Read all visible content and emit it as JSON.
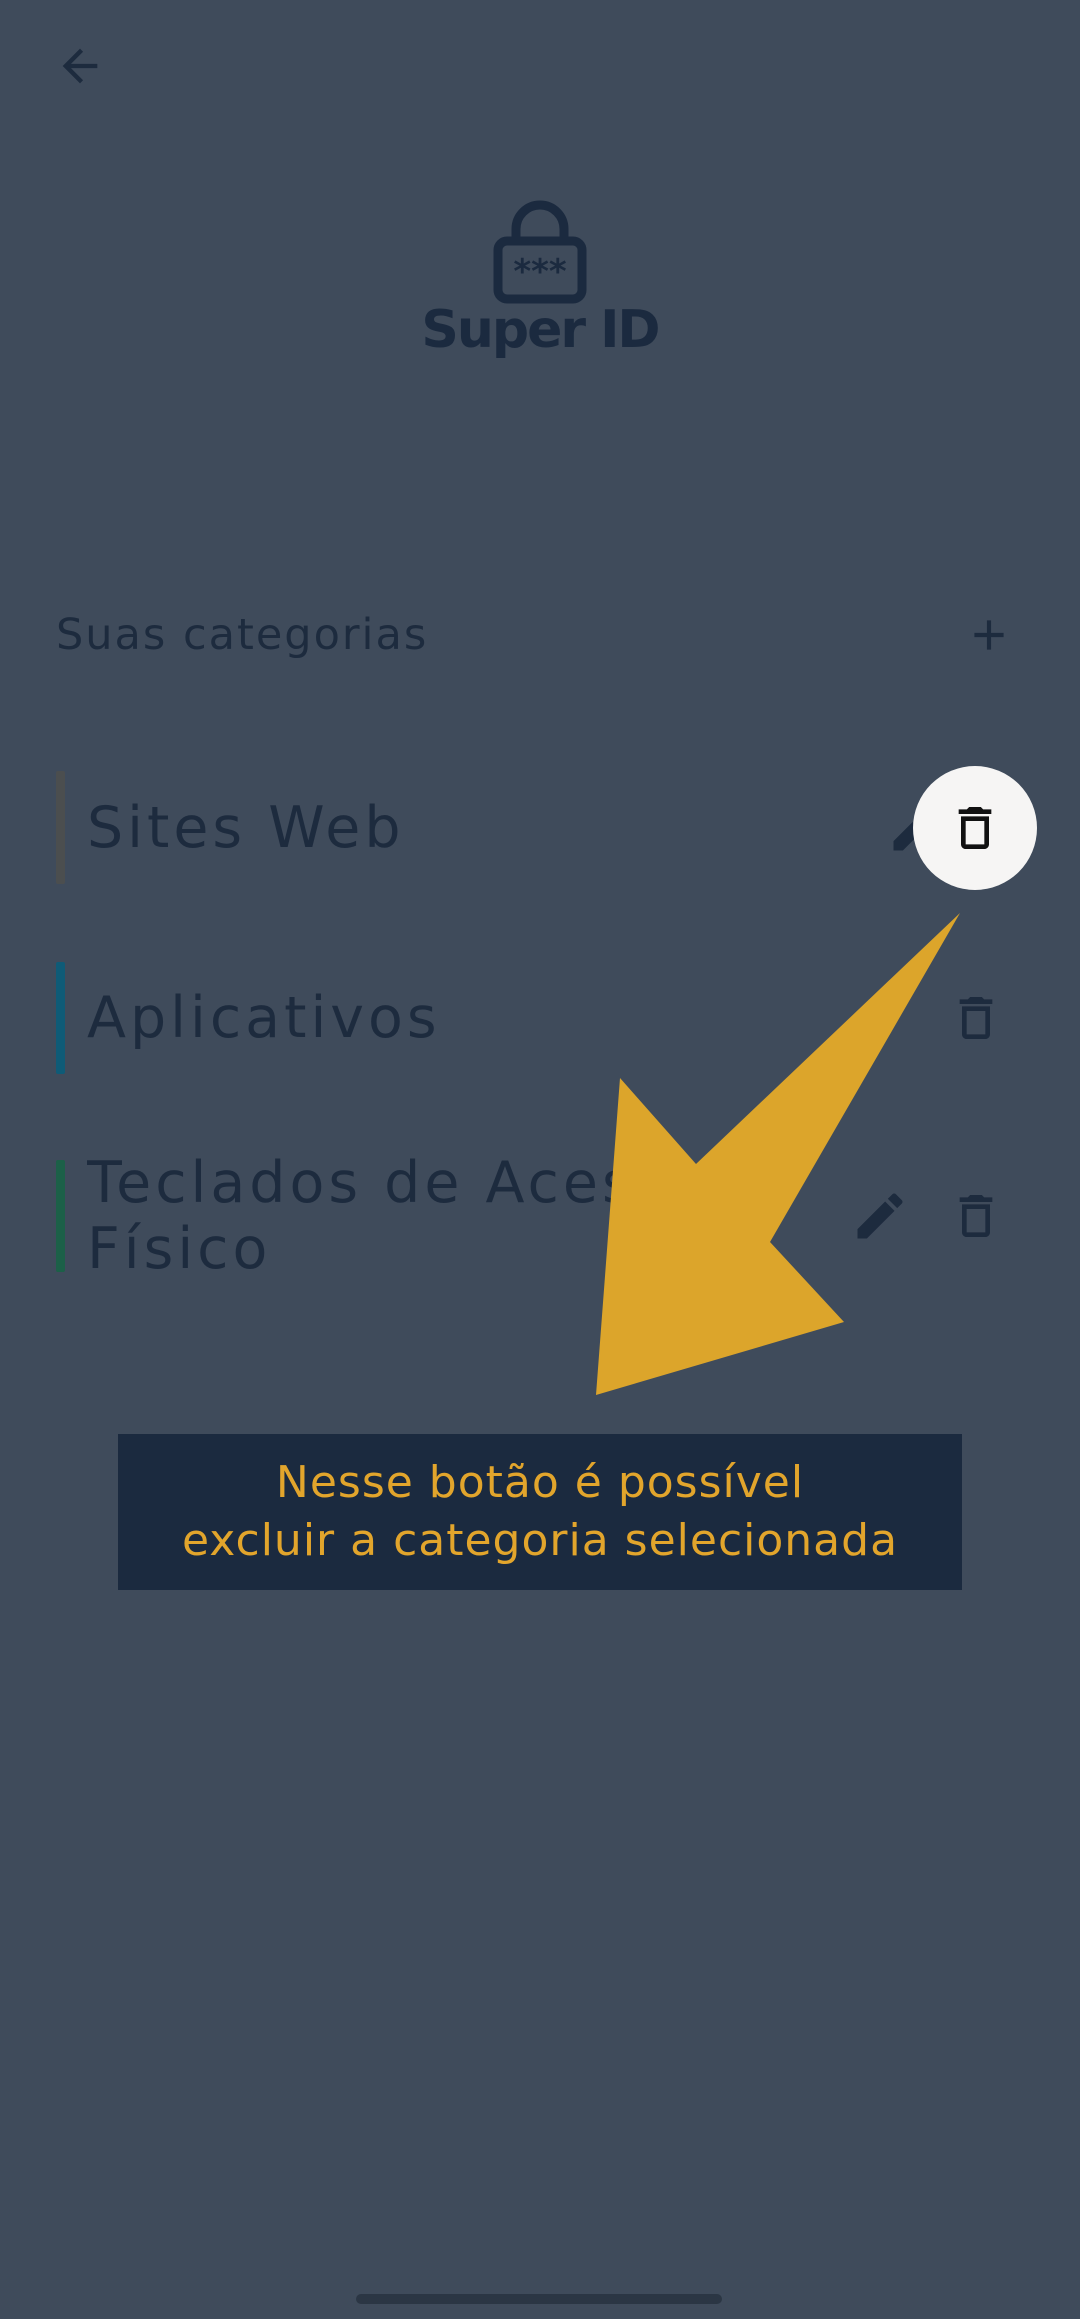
{
  "header": {
    "back_icon": "arrow-left-icon",
    "app_icon": "lock-icon",
    "app_name": "Super ID"
  },
  "categories_section": {
    "title": "Suas categorias",
    "add_icon": "plus-icon"
  },
  "categories": [
    {
      "label": "Sites Web",
      "color": "#4b4e4f",
      "editable": true
    },
    {
      "label": "Aplicativos",
      "color": "#0f5b77",
      "editable": false
    },
    {
      "label": "Teclados de Acess\nFísico",
      "color": "#1c6048",
      "editable": true
    }
  ],
  "tutorial": {
    "line1": "Nesse botão é possível",
    "line2": "excluir a categoria selecionada",
    "highlight_color": "#f6f5f4",
    "arrow_color": "#dca52b"
  },
  "colors": {
    "background": "#3f4b5b",
    "text_dark": "#1d2b3e",
    "tooltip_bg": "#1b2a3f",
    "tooltip_text": "#e2a52c"
  }
}
